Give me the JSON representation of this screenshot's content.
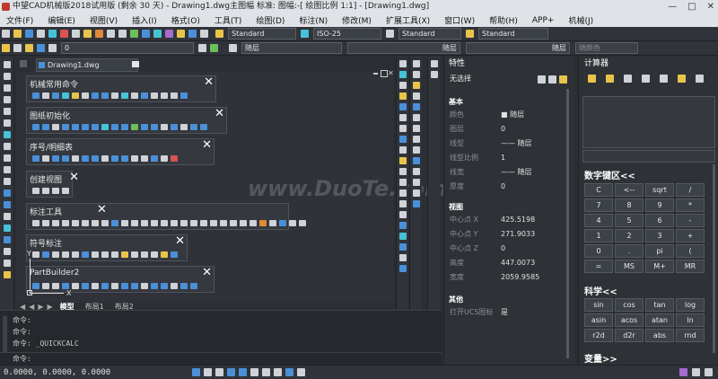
{
  "title": "中望CAD机械版2018试用版 (剩余 30 天) - Drawing1.dwg主图幅  标准: 图幅:-[ 绘图比例 1:1] - [Drawing1.dwg]",
  "window_buttons": [
    "—",
    "□",
    "✕"
  ],
  "menu": [
    "文件(F)",
    "编辑(E)",
    "视图(V)",
    "插入(I)",
    "格式(O)",
    "工具(T)",
    "绘图(D)",
    "标注(N)",
    "修改(M)",
    "扩展工具(X)",
    "窗口(W)",
    "帮助(H)",
    "APP+",
    "机械(J)"
  ],
  "toolbar": {
    "text_style": "Standard",
    "dim_style": "ISO-25",
    "table_style": "Standard",
    "mleader_style": "Standard",
    "layer_value": "0",
    "color": "随层",
    "linetype": "随层",
    "lineweight": "随层",
    "plot_style": "随颜色"
  },
  "drawing_tab": "Drawing1.dwg",
  "palettes": [
    {
      "title": "机械常用命令"
    },
    {
      "title": "图纸初始化"
    },
    {
      "title": "序号/明细表"
    },
    {
      "title": "创建视图"
    },
    {
      "title": "标注工具"
    },
    {
      "title": "符号标注"
    },
    {
      "title": "PartBuilder2"
    }
  ],
  "layout_tabs": [
    "模型",
    "布局1",
    "布局2"
  ],
  "ucs": {
    "x": "X",
    "y": "Y"
  },
  "properties": {
    "header": "特性",
    "selection": "无选择",
    "sections": {
      "basic": "基本",
      "view": "视图",
      "misc": "其他"
    },
    "basic_rows": [
      {
        "k": "颜色",
        "v": "■ 随层"
      },
      {
        "k": "图层",
        "v": "0"
      },
      {
        "k": "线型",
        "v": "—— 随层"
      },
      {
        "k": "线型比例",
        "v": "1"
      },
      {
        "k": "线宽",
        "v": "—— 随层"
      },
      {
        "k": "厚度",
        "v": "0"
      }
    ],
    "view_rows": [
      {
        "k": "中心点 X",
        "v": "425.5198"
      },
      {
        "k": "中心点 Y",
        "v": "271.9033"
      },
      {
        "k": "中心点 Z",
        "v": "0"
      },
      {
        "k": "高度",
        "v": "447.0073"
      },
      {
        "k": "宽度",
        "v": "2059.9585"
      }
    ],
    "misc_rows": [
      {
        "k": "打开UCS图标",
        "v": "是"
      }
    ]
  },
  "calculator": {
    "header": "计算器",
    "keypad_title": "数字键区<<",
    "keys": [
      "C",
      "<--",
      "sqrt",
      "/",
      "7",
      "8",
      "9",
      "*",
      "4",
      "5",
      "6",
      "-",
      "1",
      "2",
      "3",
      "+",
      "0",
      ".",
      "pi",
      "(",
      "=",
      "MS",
      "M+",
      "MR"
    ],
    "sci_title": "科学<<",
    "sci_keys": [
      "sin",
      "cos",
      "tan",
      "log",
      "asin",
      "acos",
      "atan",
      "ln",
      "r2d",
      "d2r",
      "abs",
      "rnd"
    ],
    "var_title": "变量>>"
  },
  "command": {
    "lines": [
      "命令:",
      "命令:",
      "命令: _QUICKCALC"
    ],
    "prompt": "命令:"
  },
  "status": {
    "coords": "0.0000, 0.0000, 0.0000"
  },
  "watermark": "www.DuoTe.com"
}
